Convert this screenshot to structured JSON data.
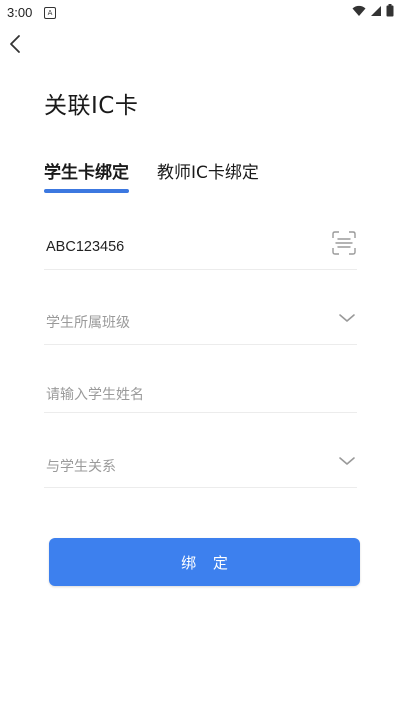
{
  "status_bar": {
    "time": "3:00",
    "notif_glyph": "A"
  },
  "header": {
    "title": "关联IC卡"
  },
  "tabs": [
    {
      "label": "学生卡绑定",
      "active": true
    },
    {
      "label": "教师IC卡绑定",
      "active": false
    }
  ],
  "form": {
    "card_number": {
      "value": "ABC123456",
      "right_icon": "scan-icon"
    },
    "class_select": {
      "placeholder": "学生所属班级",
      "right_icon": "chevron-down-icon"
    },
    "student_name": {
      "placeholder": "请输入学生姓名"
    },
    "relation_select": {
      "placeholder": "与学生关系",
      "right_icon": "chevron-down-icon"
    }
  },
  "submit": {
    "label": "绑 定"
  },
  "colors": {
    "accent": "#3d80ee",
    "underline": "#3c78e0",
    "placeholder": "#9a9a9a",
    "divider": "#ececec"
  }
}
